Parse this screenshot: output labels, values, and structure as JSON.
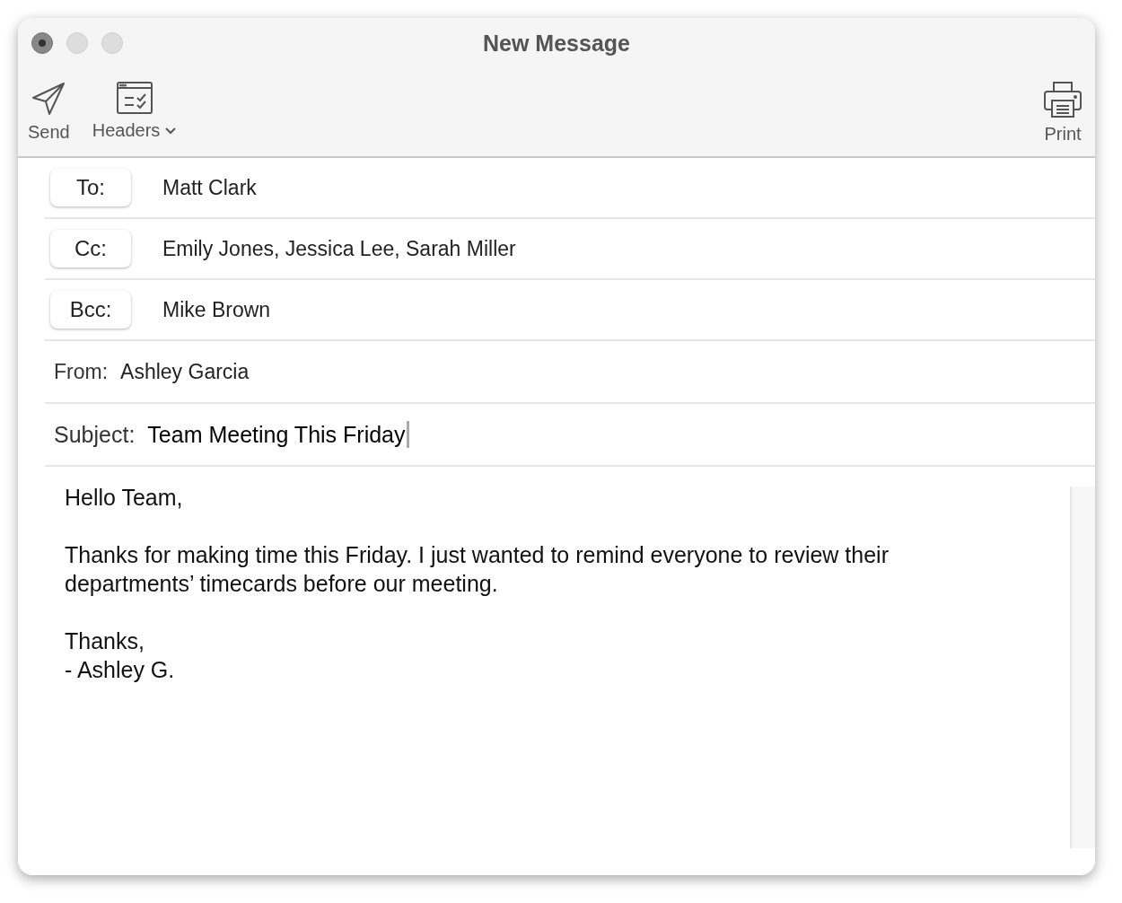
{
  "window": {
    "title": "New Message"
  },
  "toolbar": {
    "left": [
      {
        "kind": "send",
        "label": "Send",
        "dropdown": false
      },
      {
        "kind": "headers",
        "label": "Headers",
        "dropdown": true
      }
    ],
    "right": [
      {
        "kind": "print",
        "label": "Print",
        "dropdown": false
      }
    ]
  },
  "recipients": [
    {
      "button": "To:",
      "value": "Matt Clark"
    },
    {
      "button": "Cc:",
      "value": "Emily Jones, Jessica Lee, Sarah Miller"
    },
    {
      "button": "Bcc:",
      "value": "Mike Brown"
    }
  ],
  "from": {
    "label": "From:",
    "value": "Ashley Garcia"
  },
  "subject": {
    "label": "Subject:",
    "value": "Team Meeting This Friday"
  },
  "body": [
    [
      "Hello Team,"
    ],
    [
      "Thanks for making time this Friday. I just wanted to remind everyone to review their departments’ timecards before our meeting."
    ],
    [
      "Thanks,",
      "- Ashley G."
    ]
  ]
}
